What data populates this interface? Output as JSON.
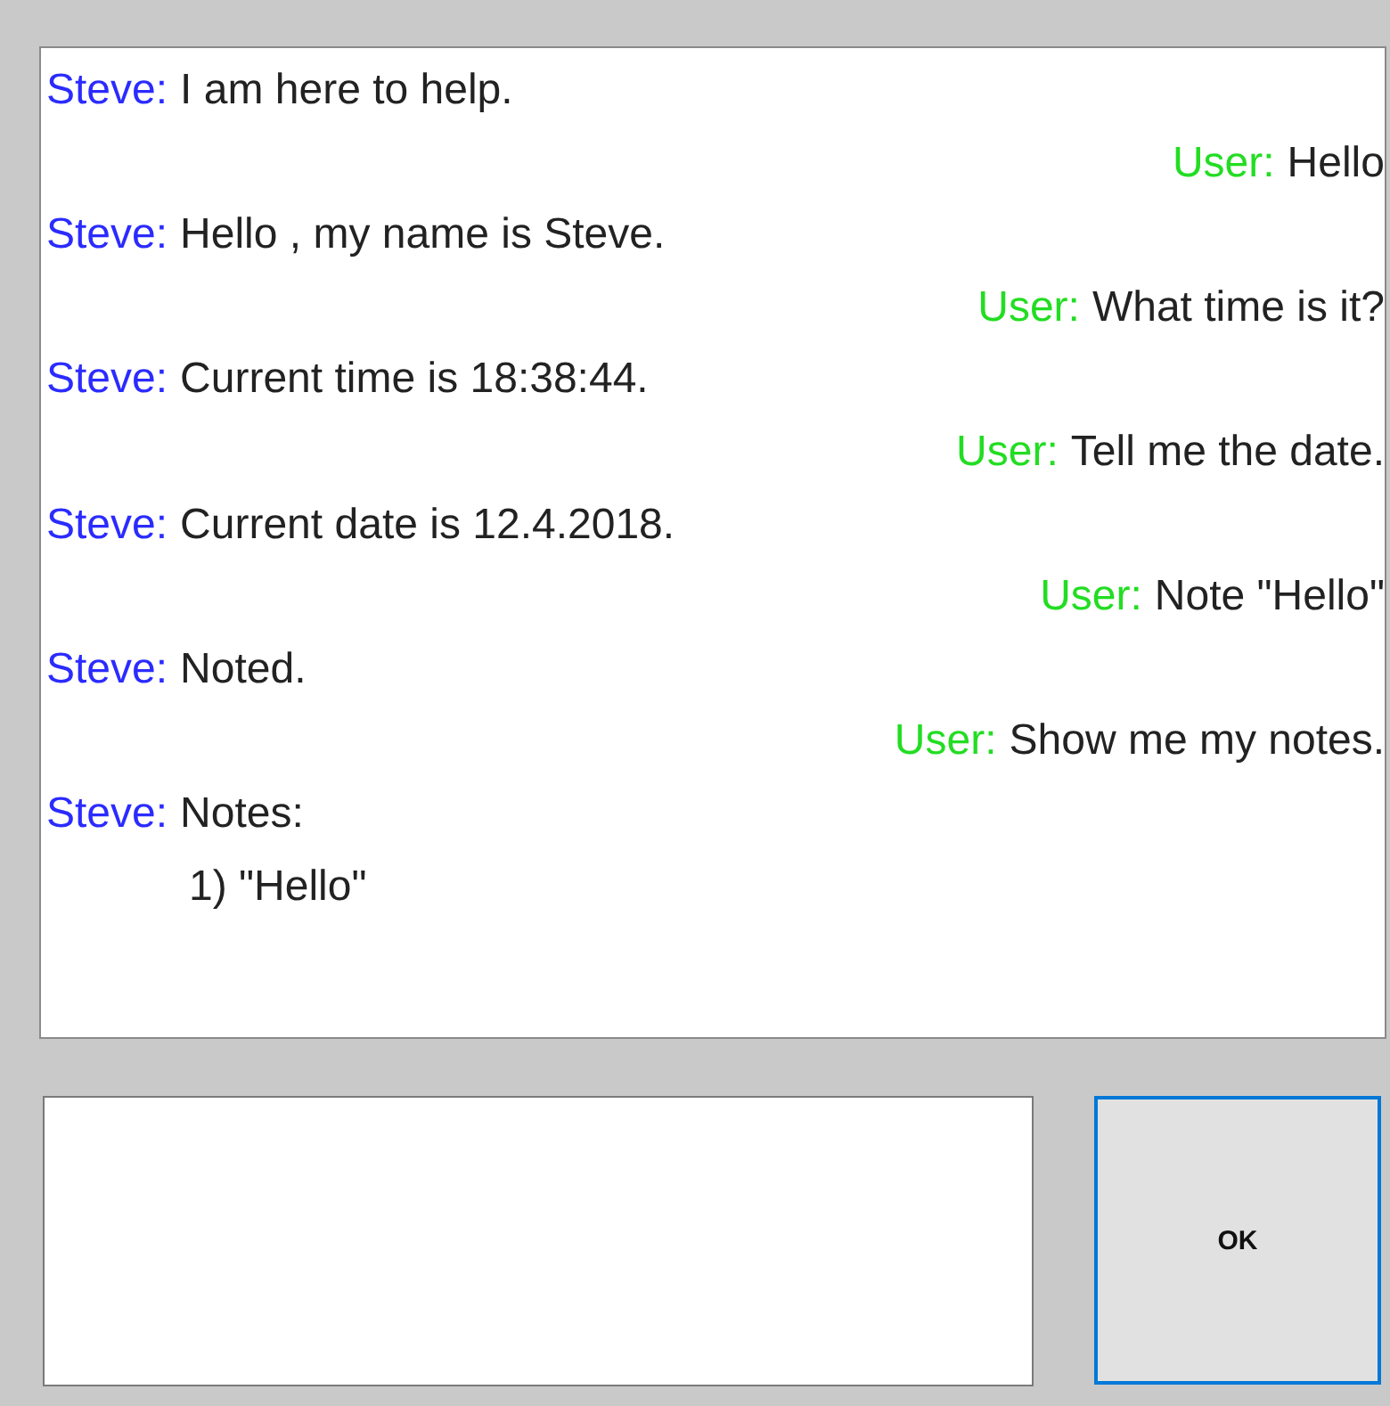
{
  "messages": [
    {
      "kind": "bot",
      "speaker": "Steve:",
      "text": "I am here to help."
    },
    {
      "kind": "user",
      "speaker": "User:",
      "text": "Hello"
    },
    {
      "kind": "bot",
      "speaker": "Steve:",
      "text": "Hello , my name is Steve."
    },
    {
      "kind": "user",
      "speaker": "User:",
      "text": "What time is it?"
    },
    {
      "kind": "bot",
      "speaker": "Steve:",
      "text": "Current time is 18:38:44."
    },
    {
      "kind": "user",
      "speaker": "User:",
      "text": "Tell me the date."
    },
    {
      "kind": "bot",
      "speaker": "Steve:",
      "text": "Current date is 12.4.2018."
    },
    {
      "kind": "user",
      "speaker": "User:",
      "text": "Note \"Hello\""
    },
    {
      "kind": "bot",
      "speaker": "Steve:",
      "text": "Noted."
    },
    {
      "kind": "user",
      "speaker": "User:",
      "text": "Show me my notes."
    },
    {
      "kind": "bot",
      "speaker": "Steve:",
      "text": "Notes:",
      "items": [
        "1) \"Hello\""
      ]
    }
  ],
  "ok_button": {
    "label": "OK"
  }
}
